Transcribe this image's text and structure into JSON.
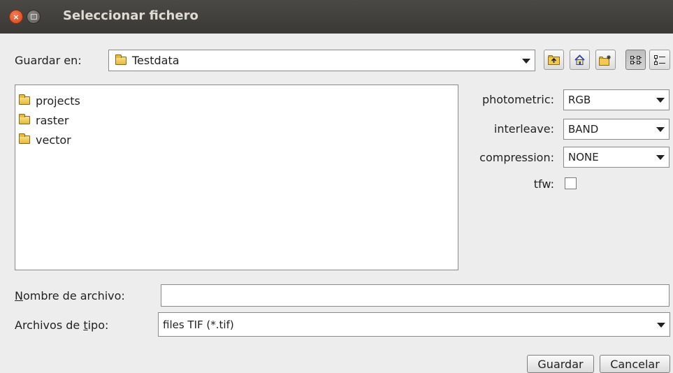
{
  "window": {
    "title": "Seleccionar fichero"
  },
  "save_in": {
    "label": "Guardar en:",
    "value": "Testdata"
  },
  "toolbar": [
    "up-folder-icon",
    "home-icon",
    "new-folder-icon",
    "list-view-icon",
    "details-view-icon"
  ],
  "files": [
    {
      "name": "projects"
    },
    {
      "name": "raster"
    },
    {
      "name": "vector"
    }
  ],
  "options": {
    "photometric": {
      "label": "photometric:",
      "value": "RGB"
    },
    "interleave": {
      "label": "interleave:",
      "value": "BAND"
    },
    "compression": {
      "label": "compression:",
      "value": "NONE"
    },
    "tfw": {
      "label": "tfw:",
      "checked": false
    }
  },
  "filename": {
    "label_first": "N",
    "label_rest": "ombre de archivo:",
    "value": ""
  },
  "filetype": {
    "label_a": "Archivos de ",
    "label_t": "t",
    "label_b": "ipo:",
    "value": "files TIF (*.tif)"
  },
  "buttons": {
    "save": "Guardar",
    "cancel": "Cancelar"
  },
  "colors": {
    "titlebar": "#3c3b37",
    "close": "#e95420",
    "background": "#ededed"
  }
}
